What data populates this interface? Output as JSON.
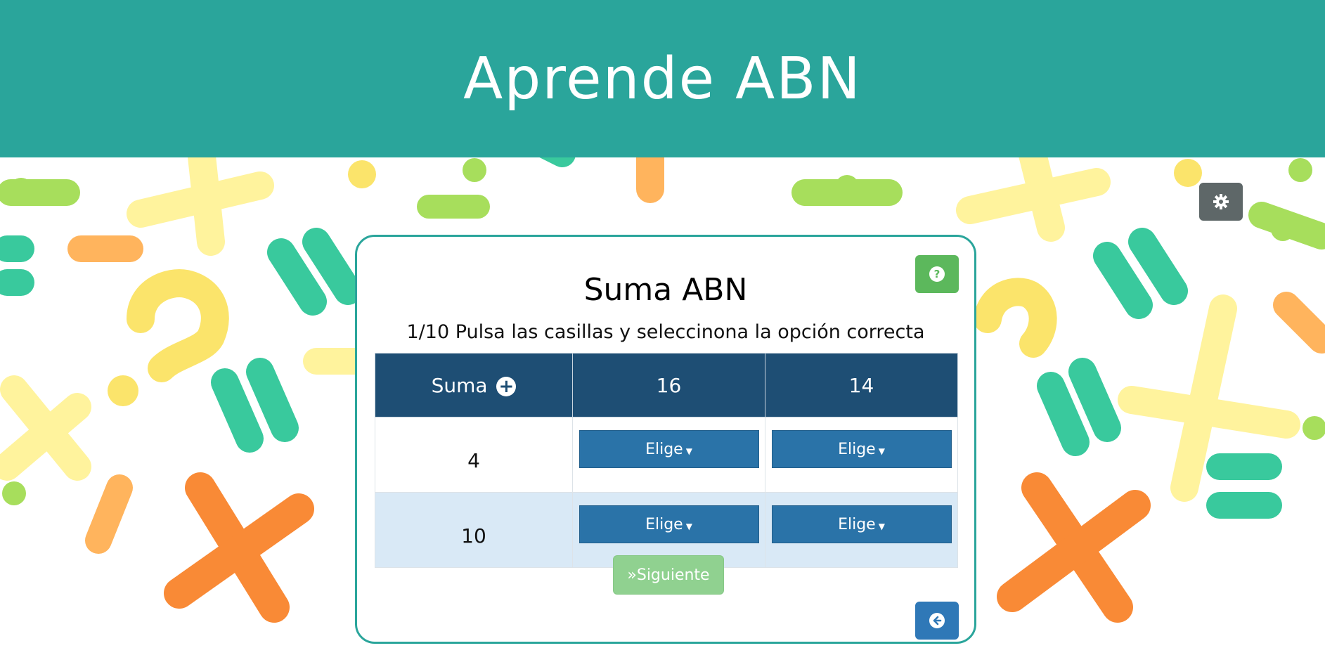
{
  "header": {
    "title": "Aprende ABN"
  },
  "settings": {
    "icon": "gear-icon"
  },
  "card": {
    "title": "Suma ABN",
    "subtitle": "1/10 Pulsa las casillas y seleccinona la opción correcta",
    "help_icon": "question-circle-icon",
    "table": {
      "corner_label": "Suma",
      "corner_icon": "plus-circle-icon",
      "columns": [
        "16",
        "14"
      ],
      "rows": [
        {
          "label": "4",
          "cells": [
            "Elige",
            "Elige"
          ]
        },
        {
          "label": "10",
          "cells": [
            "Elige",
            "Elige"
          ]
        }
      ]
    },
    "next_button": "»Siguiente",
    "back_icon": "arrow-left-circle-icon"
  },
  "colors": {
    "header_bg": "#2aa59b",
    "table_header_bg": "#1e4e74",
    "select_button_bg": "#2a73a8",
    "next_button_bg": "#90d190",
    "help_button_bg": "#5cb85c",
    "back_button_bg": "#2f78b7",
    "settings_button_bg": "#5e6768"
  }
}
